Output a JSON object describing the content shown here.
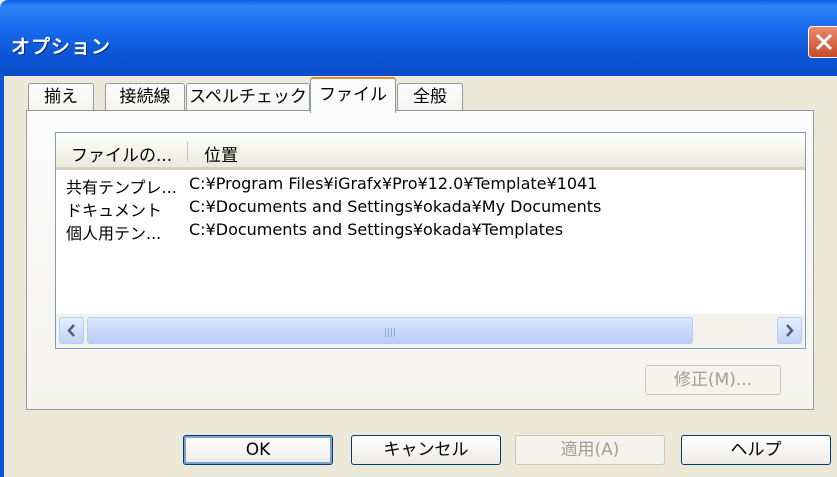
{
  "window": {
    "title": "オプション"
  },
  "tabs": [
    {
      "label": "揃え"
    },
    {
      "label": "接続線"
    },
    {
      "label": "スペルチェック"
    },
    {
      "label": "ファイル"
    },
    {
      "label": "全般"
    }
  ],
  "active_tab": "ファイル",
  "file_list": {
    "columns": [
      "ファイルの...",
      "位置"
    ],
    "rows": [
      {
        "type": "共有テンプレ...",
        "location": "C:¥Program Files¥iGrafx¥Pro¥12.0¥Template¥1041"
      },
      {
        "type": "ドキュメント",
        "location": "C:¥Documents and Settings¥okada¥My Documents"
      },
      {
        "type": "個人用テン...",
        "location": "C:¥Documents and Settings¥okada¥Templates"
      }
    ]
  },
  "modify_button": "修正(M)...",
  "buttons": {
    "ok": "OK",
    "cancel": "キャンセル",
    "apply": "適用(A)",
    "help": "ヘルプ"
  }
}
